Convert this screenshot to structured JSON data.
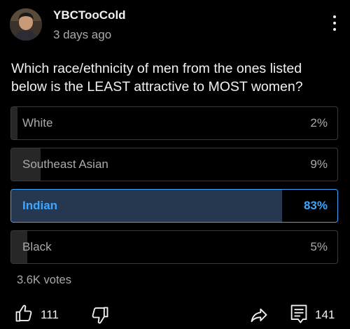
{
  "post": {
    "author": "YBCTooCold",
    "time": "3 days ago",
    "question": "Which race/ethnicity of men from the ones listed below is the LEAST attractive to MOST women?"
  },
  "poll": {
    "options": [
      {
        "label": "White",
        "percent_text": "2%",
        "percent": 2,
        "selected": false
      },
      {
        "label": "Southeast Asian",
        "percent_text": "9%",
        "percent": 9,
        "selected": false
      },
      {
        "label": "Indian",
        "percent_text": "83%",
        "percent": 83,
        "selected": true
      },
      {
        "label": "Black",
        "percent_text": "5%",
        "percent": 5,
        "selected": false
      }
    ],
    "votes": "3.6K votes"
  },
  "actions": {
    "like_count": "111",
    "comment_count": "141"
  },
  "icons": {
    "avatar": "avatar",
    "menu": "more-vert-icon",
    "like": "thumbs-up-icon",
    "dislike": "thumbs-down-icon",
    "share": "share-icon",
    "comment": "comment-icon"
  },
  "colors": {
    "background": "#000000",
    "text": "#f1f1f1",
    "secondary_text": "#aaaaaa",
    "selected_accent": "#3ea6ff",
    "selected_fill": "#263850",
    "option_fill": "#272727",
    "option_border": "#3a3a3a"
  }
}
